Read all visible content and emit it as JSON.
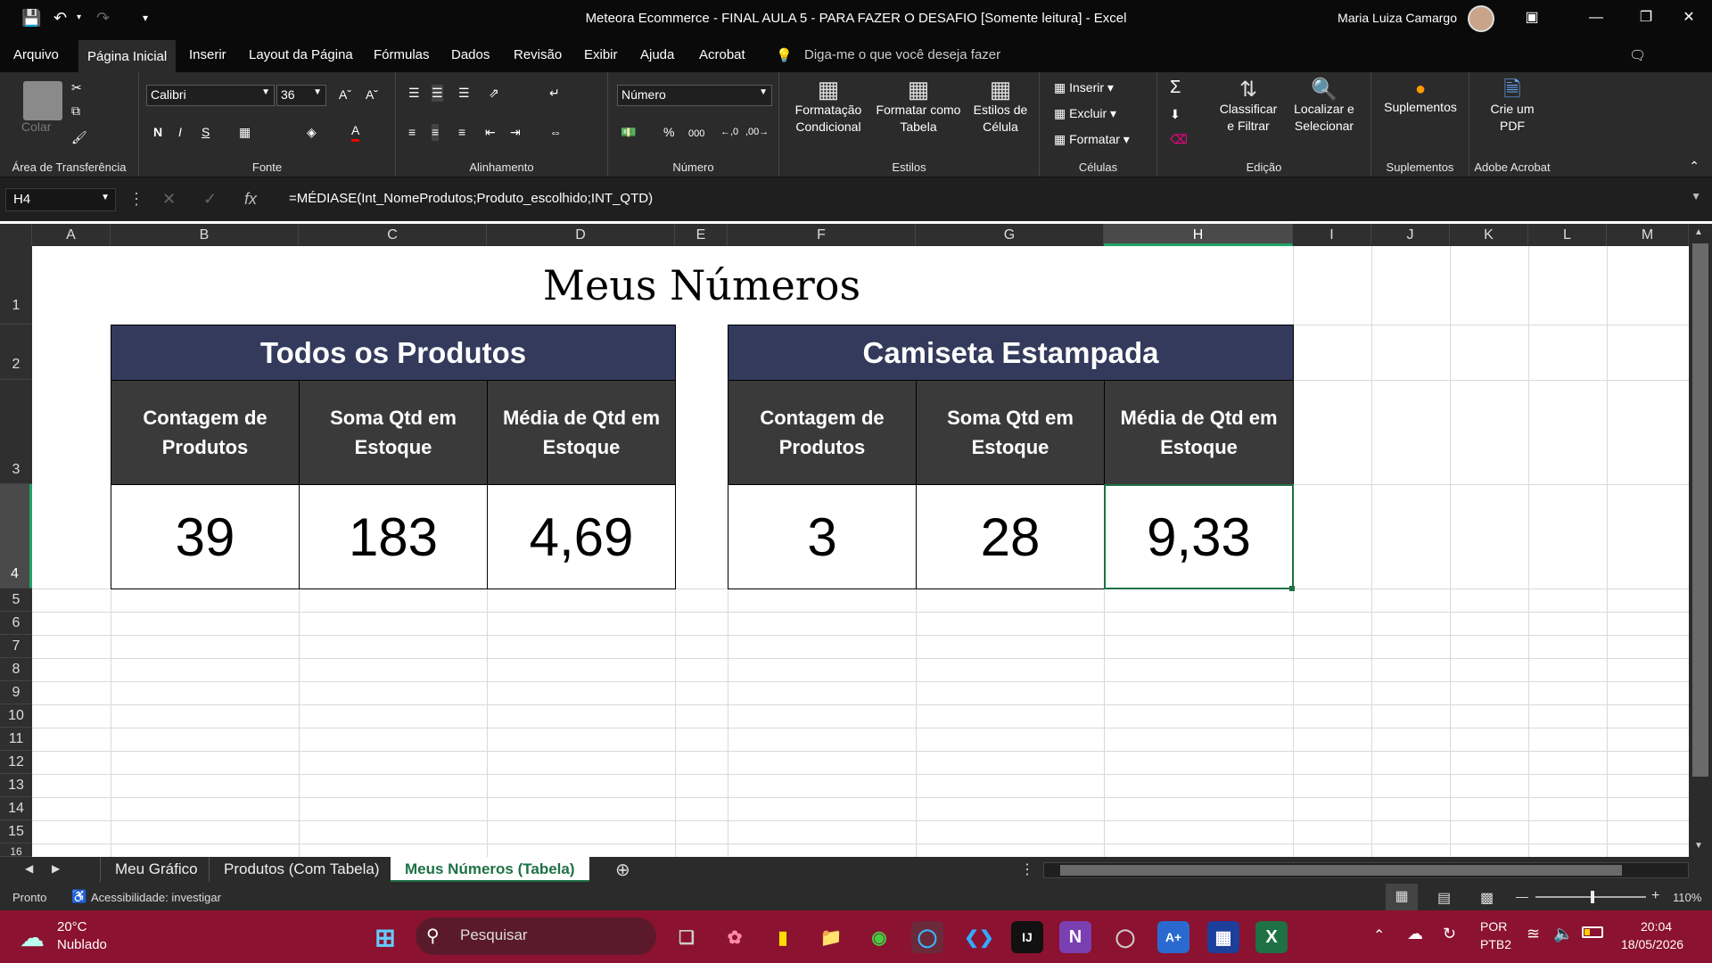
{
  "titlebar": {
    "title": "Meteora Ecommerce - FINAL AULA 5 - PARA FAZER O DESAFIO  [Somente leitura]  -  Excel",
    "user": "Maria Luiza Camargo"
  },
  "tabs": [
    "Arquivo",
    "Página Inicial",
    "Inserir",
    "Layout da Página",
    "Fórmulas",
    "Dados",
    "Revisão",
    "Exibir",
    "Ajuda",
    "Acrobat"
  ],
  "tell_me": "Diga-me o que você deseja fazer",
  "ribbon": {
    "clipboard": {
      "paste": "Colar",
      "label": "Área de Transferência"
    },
    "font": {
      "family": "Calibri",
      "size": "36",
      "bold": "N",
      "italic": "I",
      "underline": "S",
      "label": "Fonte"
    },
    "alignment": {
      "label": "Alinhamento"
    },
    "number": {
      "format": "Número",
      "percent": "%",
      "thousands": "000",
      "label": "Número"
    },
    "styles": {
      "conditional": "Formatação Condicional",
      "format_table": "Formatar como Tabela",
      "cell_styles": "Estilos de Célula",
      "label": "Estilos"
    },
    "cells": {
      "insert": "Inserir",
      "delete": "Excluir",
      "format": "Formatar",
      "label": "Células"
    },
    "editing": {
      "sort": "Classificar e Filtrar",
      "find": "Localizar e Selecionar",
      "label": "Edição"
    },
    "addins": {
      "btn": "Suplementos",
      "label": "Suplementos"
    },
    "acrobat": {
      "btn": "Crie um PDF",
      "label": "Adobe Acrobat"
    }
  },
  "formula_bar": {
    "name_box": "H4",
    "formula": "=MÉDIASE(Int_NomeProdutos;Produto_escolhido;INT_QTD)"
  },
  "columns": [
    "A",
    "B",
    "C",
    "D",
    "E",
    "F",
    "G",
    "H",
    "I",
    "J",
    "K",
    "L",
    "M"
  ],
  "rows": [
    "1",
    "2",
    "3",
    "4",
    "5",
    "6",
    "7",
    "8",
    "9",
    "10",
    "11",
    "12",
    "13",
    "14",
    "15",
    "16"
  ],
  "sheet": {
    "title": "Meus Números",
    "left_header": "Todos os Produtos",
    "right_header": "Camiseta Estampada",
    "sub": [
      "Contagem de Produtos",
      "Soma Qtd em Estoque",
      "Média de Qtd em Estoque"
    ],
    "left_values": [
      "39",
      "183",
      "4,69"
    ],
    "right_values": [
      "3",
      "28",
      "9,33"
    ]
  },
  "sheet_tabs": [
    "Meu Gráfico",
    "Produtos (Com Tabela)",
    "Meus Números (Tabela)"
  ],
  "status": {
    "ready": "Pronto",
    "accessibility": "Acessibilidade: investigar",
    "zoom": "110%"
  },
  "taskbar": {
    "temp": "20°C",
    "weather": "Nublado",
    "search": "Pesquisar",
    "lang1": "POR",
    "lang2": "PTB2",
    "time": "20:04",
    "date": "18/05/2026"
  }
}
